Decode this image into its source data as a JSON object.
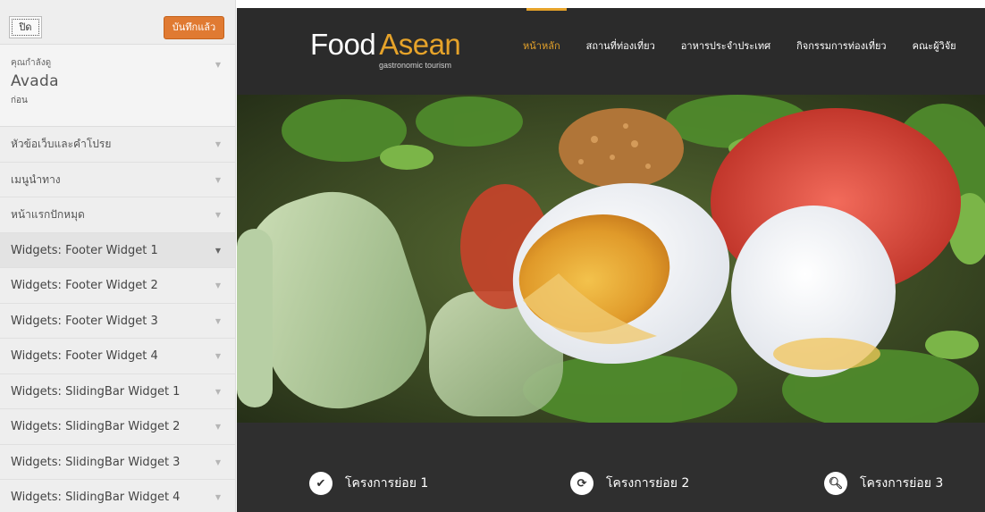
{
  "customizer": {
    "close_label": "ปิด",
    "save_label": "บันทึกแล้ว",
    "theme": {
      "viewing_label": "คุณกำลังดู",
      "name": "Avada",
      "previous_label": "ก่อน"
    },
    "sections": [
      {
        "label": "หัวข้อเว็บและคำโปรย"
      },
      {
        "label": "เมนูนำทาง"
      },
      {
        "label": "หน้าแรกปักหมุด"
      },
      {
        "label": "Widgets: Footer Widget 1"
      },
      {
        "label": "Widgets: Footer Widget 2"
      },
      {
        "label": "Widgets: Footer Widget 3"
      },
      {
        "label": "Widgets: Footer Widget 4"
      },
      {
        "label": "Widgets: SlidingBar Widget 1"
      },
      {
        "label": "Widgets: SlidingBar Widget 2"
      },
      {
        "label": "Widgets: SlidingBar Widget 3"
      },
      {
        "label": "Widgets: SlidingBar Widget 4"
      }
    ],
    "arrow_glyph": "▼"
  },
  "site": {
    "logo_food": "Food",
    "logo_asean": "Asean",
    "tagline": "gastronomic tourism",
    "nav": [
      {
        "label": "หน้าหลัก"
      },
      {
        "label": "สถานที่ท่องเที่ยว"
      },
      {
        "label": "อาหารประจำประเทศ"
      },
      {
        "label": "กิจกรรมการท่องเที่ยว"
      },
      {
        "label": "คณะผู้วิจัย"
      }
    ],
    "features": [
      {
        "label": "โครงการย่อย 1",
        "icon": "check-icon",
        "glyph": "✔"
      },
      {
        "label": "โครงการย่อย 2",
        "icon": "refresh-icon",
        "glyph": "⟳"
      },
      {
        "label": "โครงการย่อย 3",
        "icon": "search-icon",
        "glyph": "🔍︎"
      }
    ]
  },
  "colors": {
    "accent": "#e6a32a",
    "header_bg": "#2b2b2b",
    "features_bg": "#2f2f2f",
    "save_button": "#e07a32"
  }
}
